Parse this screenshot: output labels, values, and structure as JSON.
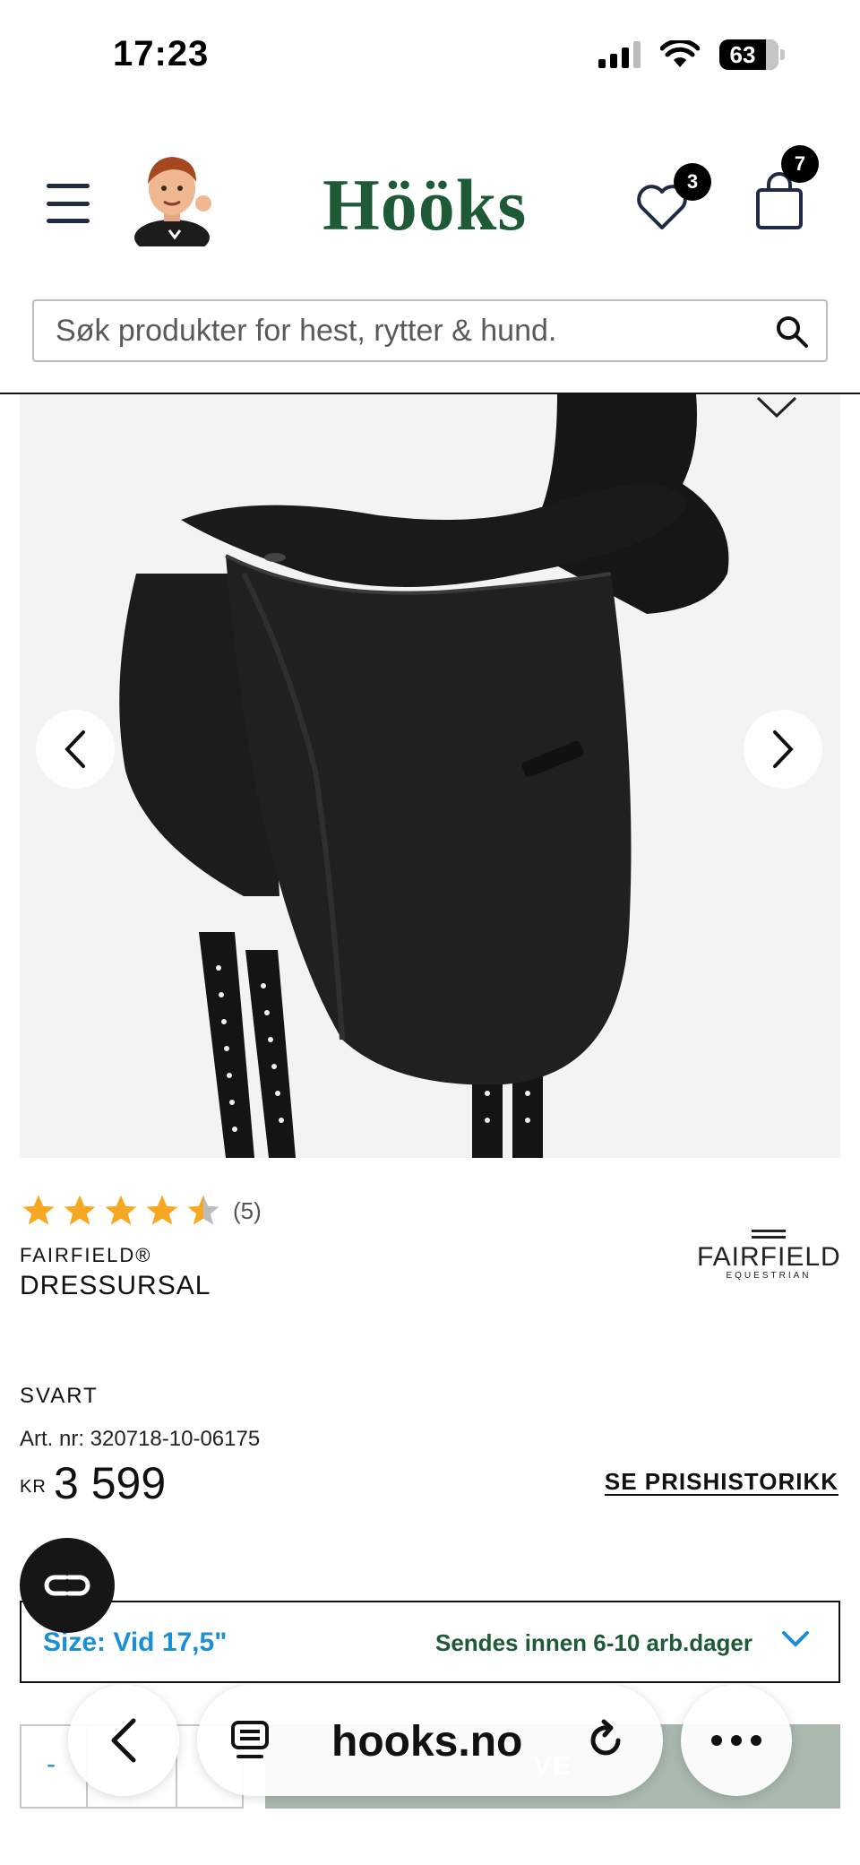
{
  "status_bar": {
    "time": "17:23",
    "battery": "63"
  },
  "header": {
    "logo": "Hööks",
    "wishlist_count": "3",
    "cart_count": "7"
  },
  "search": {
    "placeholder": "Søk produkter for hest, rytter & hund."
  },
  "product": {
    "rating_stars": 4.5,
    "rating_count": "(5)",
    "brand": "FAIRFIELD®",
    "name": "DRESSURSAL",
    "brand_logo_name": "FAIRFIELD",
    "brand_logo_sub": "EQUESTRIAN",
    "color": "SVART",
    "art_nr": "Art. nr: 320718-10-06175",
    "currency": "KR",
    "price": "3 599",
    "price_history": "SE PRISHISTORIKK",
    "size_label": "Size: Vid 17,5\"",
    "delivery": "Sendes innen 6-10 arb.dager",
    "qty_minus": "-",
    "add_to_cart": "VE"
  },
  "browser": {
    "url": "hooks.no"
  },
  "colors": {
    "brand_green": "#1d5a35",
    "link_blue": "#1a8fd6",
    "star_yellow": "#f7a823"
  }
}
